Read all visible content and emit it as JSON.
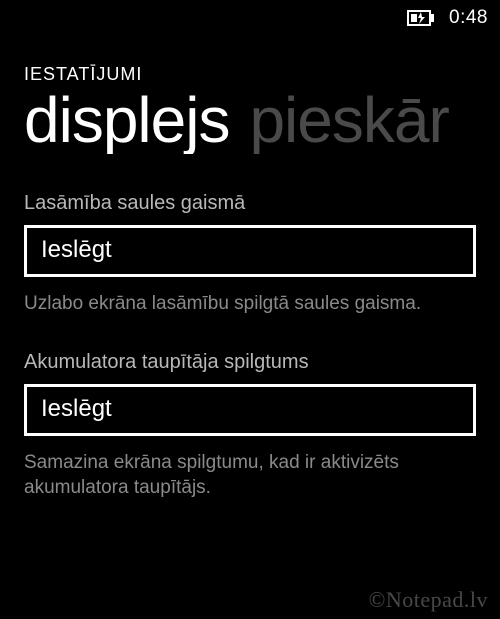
{
  "status": {
    "time": "0:48"
  },
  "header": {
    "section": "IESTATĪJUMI"
  },
  "pivot": {
    "active": "displejs",
    "next": "pieskār"
  },
  "settings": [
    {
      "label": "Lasāmība saules gaismā",
      "value": "Ieslēgt",
      "description": "Uzlabo ekrāna lasāmību spilgtā saules gaisma."
    },
    {
      "label": "Akumulatora taupītāja spilgtums",
      "value": "Ieslēgt",
      "description": "Samazina ekrāna spilgtumu, kad ir aktivizēts akumulatora taupītājs."
    }
  ],
  "watermark": "©Notepad.lv"
}
